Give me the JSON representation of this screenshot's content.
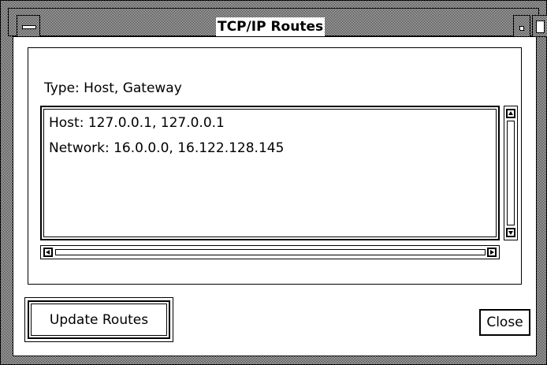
{
  "window": {
    "title": "TCP/IP Routes"
  },
  "routes": {
    "type_label": "Type: Host, Gateway",
    "items": [
      "Host: 127.0.0.1, 127.0.0.1",
      "Network: 16.0.0.0, 16.122.128.145"
    ]
  },
  "buttons": {
    "update_label": "Update Routes",
    "close_label": "Close"
  },
  "icons": [
    "window-menu-icon",
    "minimize-icon",
    "maximize-icon",
    "scroll-up-arrow-icon",
    "scroll-down-arrow-icon",
    "scroll-left-arrow-icon",
    "scroll-right-arrow-icon"
  ]
}
